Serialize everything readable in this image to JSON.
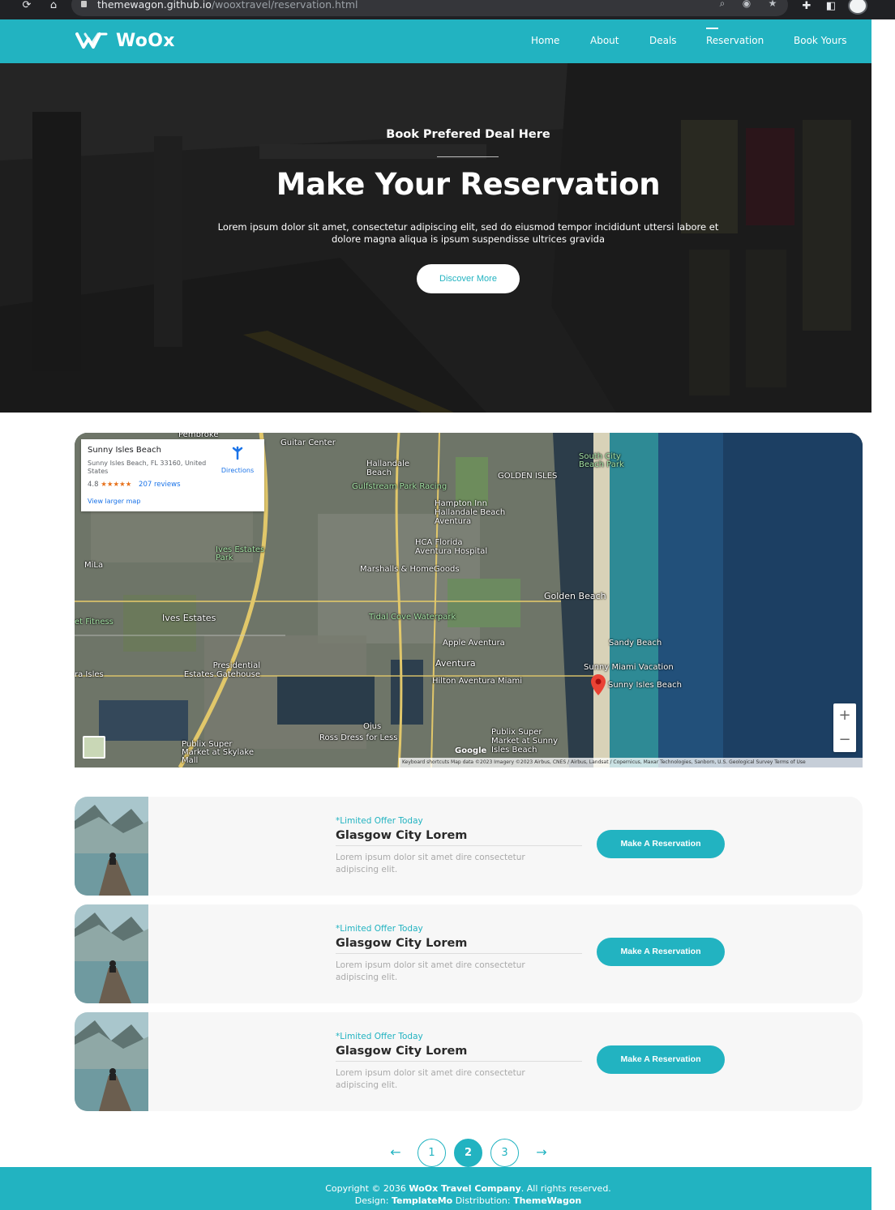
{
  "browser": {
    "url_host": "themewagon.github.io",
    "url_path": "/wooxtravel/reservation.html"
  },
  "header": {
    "logo_text": "WoOx",
    "nav": [
      {
        "label": "Home"
      },
      {
        "label": "About"
      },
      {
        "label": "Deals"
      },
      {
        "label": "Reservation",
        "active": true
      },
      {
        "label": "Book Yours"
      }
    ]
  },
  "hero": {
    "subtitle": "Book Prefered Deal Here",
    "title": "Make Your Reservation",
    "description": "Lorem ipsum dolor sit amet, consectetur adipiscing elit, sed do eiusmod tempor incididunt uttersi labore et dolore magna aliqua is ipsum suspendisse ultrices gravida",
    "button": "Discover More"
  },
  "map": {
    "place_name": "Sunny Isles Beach",
    "address": "Sunny Isles Beach, FL 33160, United States",
    "rating": "4.8",
    "stars": "★★★★★",
    "reviews": "207 reviews",
    "larger_map": "View larger map",
    "directions": "Directions",
    "labels": [
      "Pembroke",
      "Guitar Center",
      "Hallandale Beach",
      "Gulfstream Park Racing",
      "GOLDEN ISLES",
      "South City Beach Park",
      "Hampton Inn Hallandale Beach Aventura",
      "HCA Florida Aventura Hospital",
      "Ives Estates Park",
      "Marshalls & HomeGoods",
      "MiLa",
      "Golden Beach",
      "Tidal Cove Waterpark",
      "Ives Estates",
      "et Fitness",
      "Apple Aventura",
      "Sandy Beach",
      "Aventura",
      "Sunny Miami Vacation",
      "Presidential Estates Gatehouse",
      "Hilton Aventura Miami",
      "Sunny Isles Beach",
      "Publix Super Market at Sunny Isles Beach",
      "Ross Dress for Less",
      "Ojus",
      "Publix Super Market at Skylake Mall",
      "ra Isles"
    ],
    "zoom_in": "+",
    "zoom_out": "−",
    "google": "Google",
    "footer": "Keyboard shortcuts   Map data ©2023 Imagery ©2023 Airbus, CNES / Airbus, Landsat / Copernicus, Maxar Technologies, Sanborn, U.S. Geological Survey   Terms of Use"
  },
  "deals": [
    {
      "limited": "*Limited Offer Today",
      "title": "Glasgow City Lorem",
      "description": "Lorem ipsum dolor sit amet dire consectetur adipiscing elit.",
      "button": "Make A Reservation"
    },
    {
      "limited": "*Limited Offer Today",
      "title": "Glasgow City Lorem",
      "description": "Lorem ipsum dolor sit amet dire consectetur adipiscing elit.",
      "button": "Make A Reservation"
    },
    {
      "limited": "*Limited Offer Today",
      "title": "Glasgow City Lorem",
      "description": "Lorem ipsum dolor sit amet dire consectetur adipiscing elit.",
      "button": "Make A Reservation"
    }
  ],
  "pagination": {
    "prev": "←",
    "pages": [
      "1",
      "2",
      "3"
    ],
    "current": "2",
    "next": "→"
  },
  "footer": {
    "line1_prefix": "Copyright © 2036 ",
    "line1_brand": "WoOx Travel Company",
    "line1_suffix": ". All rights reserved.",
    "line2_design": "Design: ",
    "line2_design_by": "TemplateMo",
    "line2_dist": " Distribution: ",
    "line2_dist_by": "ThemeWagon"
  },
  "colors": {
    "accent": "#22b3c1",
    "card_bg": "#f7f7f7",
    "hero_dark": "#2c2c2c"
  }
}
